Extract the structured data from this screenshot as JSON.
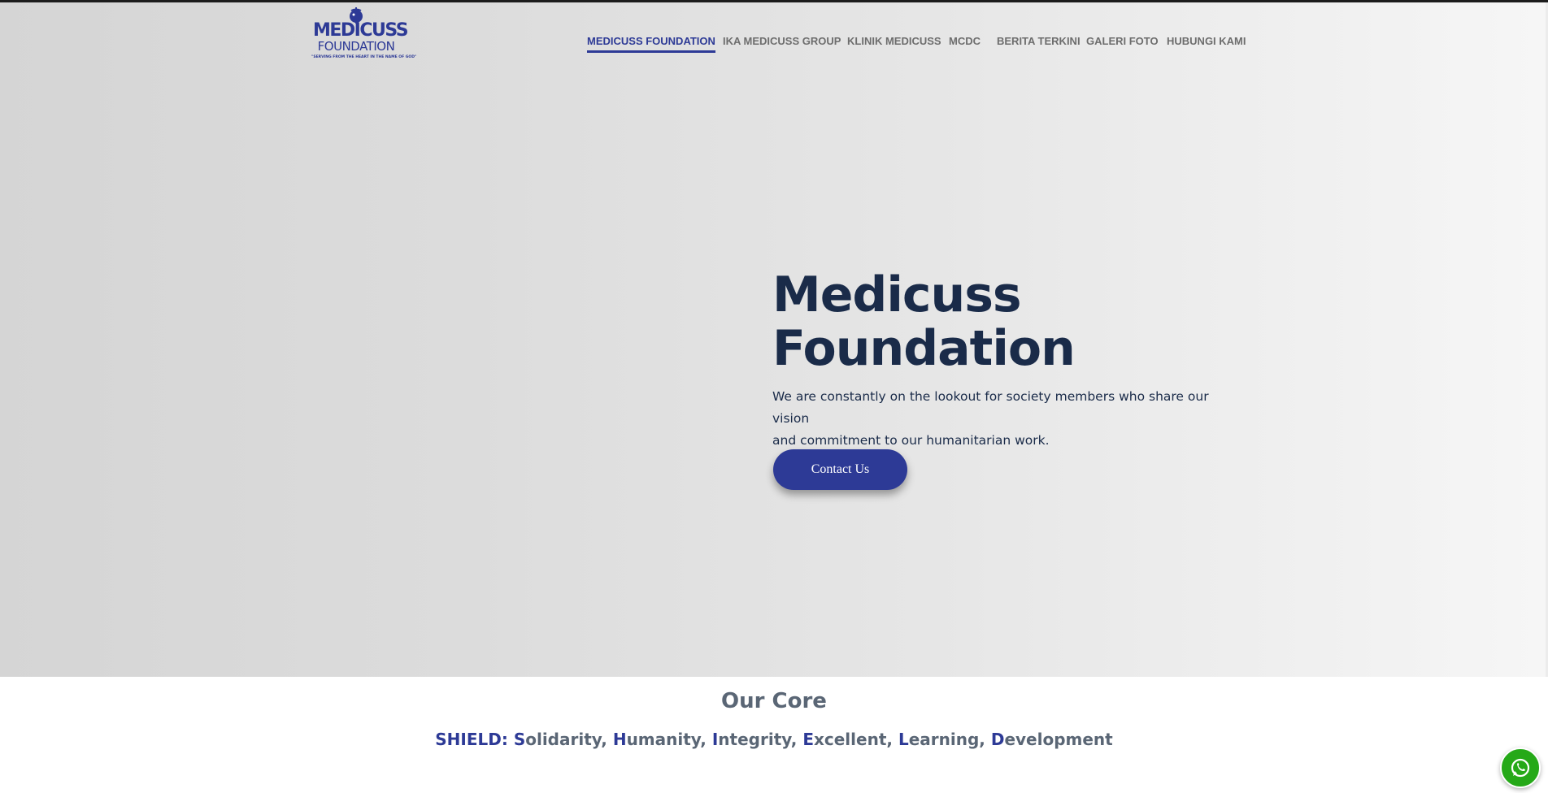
{
  "brand": {
    "name_line1": "MEDICUSS",
    "name_line2": "FOUNDATION",
    "tagline": "\"SERVING FROM THE HEART IN THE NAME OF GOD\"",
    "color": "#2d3a96"
  },
  "nav": {
    "items": [
      {
        "label": "MEDICUSS FOUNDATION",
        "active": true
      },
      {
        "label": "IKA MEDICUSS GROUP",
        "active": false
      },
      {
        "label": "KLINIK MEDICUSS",
        "active": false
      },
      {
        "label": "MCDC",
        "active": false
      },
      {
        "label": "BERITA TERKINI",
        "active": false
      },
      {
        "label": "GALERI FOTO",
        "active": false
      },
      {
        "label": "HUBUNGI KAMI",
        "active": false
      }
    ]
  },
  "hero": {
    "title_line1": "Medicuss",
    "title_line2": "Foundation",
    "subtitle_line1": "We are constantly on the lookout for society members who share our vision",
    "subtitle_line2": "and commitment to our humanitarian work.",
    "cta_label": "Contact Us"
  },
  "core": {
    "title": "Our Core",
    "values_prefix": "SHIELD:",
    "values": [
      {
        "initial": "S",
        "rest": "olidarity"
      },
      {
        "initial": "H",
        "rest": "umanity"
      },
      {
        "initial": "I",
        "rest": "ntegrity"
      },
      {
        "initial": "E",
        "rest": "xcellent"
      },
      {
        "initial": "L",
        "rest": "earning"
      },
      {
        "initial": "D",
        "rest": "evelopment"
      }
    ]
  },
  "floating": {
    "whatsapp_icon": "whatsapp-icon"
  },
  "colors": {
    "accent": "#2d3a96",
    "heading": "#1a2b49",
    "muted": "#5a6675",
    "whatsapp": "#25a918"
  }
}
